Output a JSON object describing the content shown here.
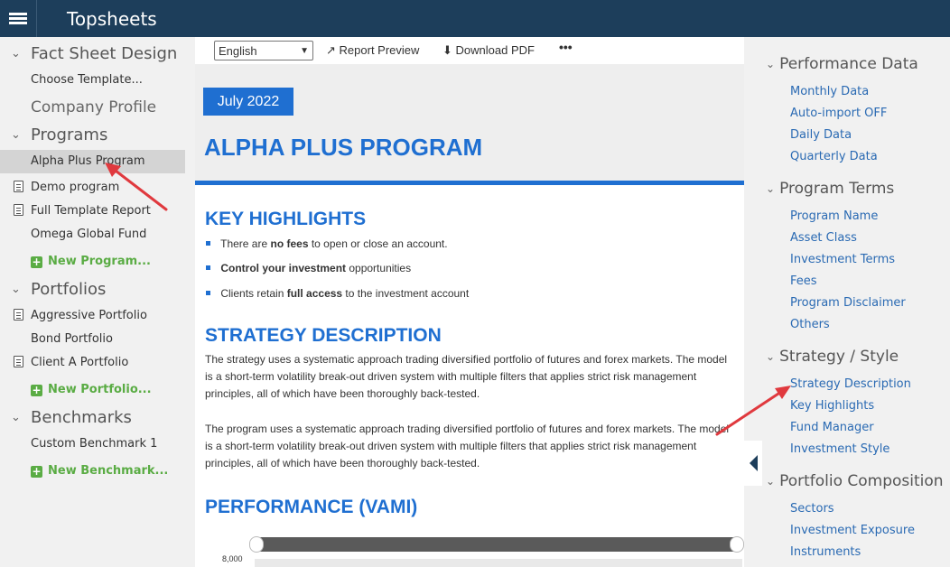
{
  "app": {
    "title": "Topsheets"
  },
  "leftnav": {
    "fact_sheet_design": "Fact Sheet Design",
    "choose_template": "Choose Template...",
    "company_profile": "Company Profile",
    "programs_label": "Programs",
    "programs": [
      "Alpha Plus Program",
      "Demo program",
      "Full Template Report",
      "Omega Global Fund"
    ],
    "new_program": "New Program...",
    "portfolios_label": "Portfolios",
    "portfolios": [
      "Aggressive Portfolio",
      "Bond Portfolio",
      "Client A Portfolio"
    ],
    "new_portfolio": "New Portfolio...",
    "benchmarks_label": "Benchmarks",
    "benchmarks": [
      "Custom Benchmark 1"
    ],
    "new_benchmark": "New Benchmark..."
  },
  "toolbar": {
    "language": "English",
    "report_preview": "Report Preview",
    "download_pdf": "Download PDF",
    "more": "•••"
  },
  "document": {
    "date": "July  2022",
    "program_title": "ALPHA PLUS PROGRAM",
    "key_highlights_heading": "KEY HIGHLIGHTS",
    "highlights": [
      {
        "pre": "There are ",
        "bold": "no fees",
        "post": " to open or close an account."
      },
      {
        "pre": "",
        "bold": "Control your investment",
        "post": " opportunities"
      },
      {
        "pre": "Clients retain ",
        "bold": "full access",
        "post": " to the investment account"
      }
    ],
    "strategy_heading": "STRATEGY DESCRIPTION",
    "strategy_p1": "The strategy uses a systematic approach trading diversified portfolio of futures and forex markets. The model is a short-term volatility break-out driven system with multiple filters that applies strict risk management principles, all of which have been thoroughly back-tested.",
    "strategy_p2": "The program uses a systematic approach trading diversified portfolio of futures and forex markets. The model is a short-term volatility break-out driven system with multiple filters that applies strict risk management principles, all of which have been thoroughly back-tested.",
    "performance_heading": "PERFORMANCE (VAMI)",
    "y_tick": "8,000"
  },
  "rightnav": {
    "sections": [
      {
        "label": "Performance Data",
        "items": [
          "Monthly Data",
          "Auto-import OFF",
          "Daily Data",
          "Quarterly Data"
        ]
      },
      {
        "label": "Program Terms",
        "items": [
          "Program Name",
          "Asset Class",
          "Investment Terms",
          "Fees",
          "Program Disclaimer",
          "Others"
        ]
      },
      {
        "label": "Strategy / Style",
        "items": [
          "Strategy Description",
          "Key Highlights",
          "Fund Manager",
          "Investment Style"
        ]
      },
      {
        "label": "Portfolio Composition",
        "items": [
          "Sectors",
          "Investment Exposure",
          "Instruments"
        ]
      }
    ]
  },
  "colors": {
    "accent": "#1f6fd1",
    "topbar": "#1d3e5b",
    "link": "#2a6ab3",
    "add": "#5aac44",
    "annotation": "#e0393e"
  },
  "icons": [
    "menu-icon",
    "chevron-down-icon",
    "document-icon",
    "plus-icon",
    "external-link-icon",
    "download-icon",
    "more-icon",
    "collapse-left-icon"
  ]
}
